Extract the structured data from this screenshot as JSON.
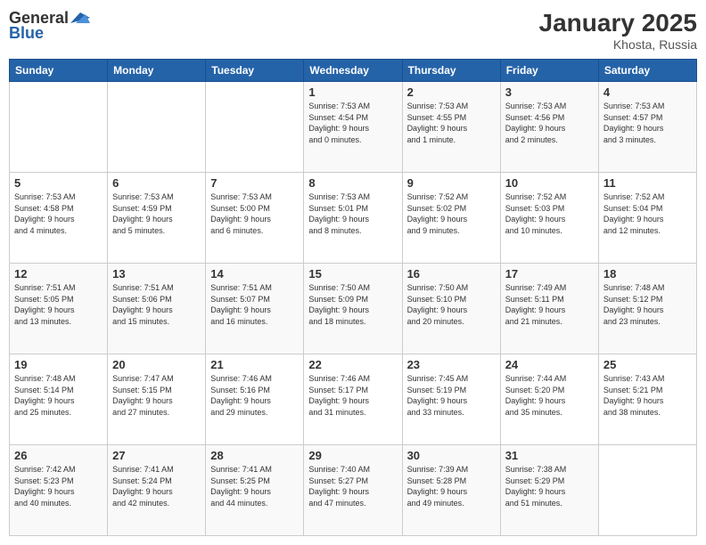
{
  "header": {
    "logo_general": "General",
    "logo_blue": "Blue",
    "month": "January 2025",
    "location": "Khosta, Russia"
  },
  "days_of_week": [
    "Sunday",
    "Monday",
    "Tuesday",
    "Wednesday",
    "Thursday",
    "Friday",
    "Saturday"
  ],
  "weeks": [
    [
      {
        "day": "",
        "info": ""
      },
      {
        "day": "",
        "info": ""
      },
      {
        "day": "",
        "info": ""
      },
      {
        "day": "1",
        "info": "Sunrise: 7:53 AM\nSunset: 4:54 PM\nDaylight: 9 hours\nand 0 minutes."
      },
      {
        "day": "2",
        "info": "Sunrise: 7:53 AM\nSunset: 4:55 PM\nDaylight: 9 hours\nand 1 minute."
      },
      {
        "day": "3",
        "info": "Sunrise: 7:53 AM\nSunset: 4:56 PM\nDaylight: 9 hours\nand 2 minutes."
      },
      {
        "day": "4",
        "info": "Sunrise: 7:53 AM\nSunset: 4:57 PM\nDaylight: 9 hours\nand 3 minutes."
      }
    ],
    [
      {
        "day": "5",
        "info": "Sunrise: 7:53 AM\nSunset: 4:58 PM\nDaylight: 9 hours\nand 4 minutes."
      },
      {
        "day": "6",
        "info": "Sunrise: 7:53 AM\nSunset: 4:59 PM\nDaylight: 9 hours\nand 5 minutes."
      },
      {
        "day": "7",
        "info": "Sunrise: 7:53 AM\nSunset: 5:00 PM\nDaylight: 9 hours\nand 6 minutes."
      },
      {
        "day": "8",
        "info": "Sunrise: 7:53 AM\nSunset: 5:01 PM\nDaylight: 9 hours\nand 8 minutes."
      },
      {
        "day": "9",
        "info": "Sunrise: 7:52 AM\nSunset: 5:02 PM\nDaylight: 9 hours\nand 9 minutes."
      },
      {
        "day": "10",
        "info": "Sunrise: 7:52 AM\nSunset: 5:03 PM\nDaylight: 9 hours\nand 10 minutes."
      },
      {
        "day": "11",
        "info": "Sunrise: 7:52 AM\nSunset: 5:04 PM\nDaylight: 9 hours\nand 12 minutes."
      }
    ],
    [
      {
        "day": "12",
        "info": "Sunrise: 7:51 AM\nSunset: 5:05 PM\nDaylight: 9 hours\nand 13 minutes."
      },
      {
        "day": "13",
        "info": "Sunrise: 7:51 AM\nSunset: 5:06 PM\nDaylight: 9 hours\nand 15 minutes."
      },
      {
        "day": "14",
        "info": "Sunrise: 7:51 AM\nSunset: 5:07 PM\nDaylight: 9 hours\nand 16 minutes."
      },
      {
        "day": "15",
        "info": "Sunrise: 7:50 AM\nSunset: 5:09 PM\nDaylight: 9 hours\nand 18 minutes."
      },
      {
        "day": "16",
        "info": "Sunrise: 7:50 AM\nSunset: 5:10 PM\nDaylight: 9 hours\nand 20 minutes."
      },
      {
        "day": "17",
        "info": "Sunrise: 7:49 AM\nSunset: 5:11 PM\nDaylight: 9 hours\nand 21 minutes."
      },
      {
        "day": "18",
        "info": "Sunrise: 7:48 AM\nSunset: 5:12 PM\nDaylight: 9 hours\nand 23 minutes."
      }
    ],
    [
      {
        "day": "19",
        "info": "Sunrise: 7:48 AM\nSunset: 5:14 PM\nDaylight: 9 hours\nand 25 minutes."
      },
      {
        "day": "20",
        "info": "Sunrise: 7:47 AM\nSunset: 5:15 PM\nDaylight: 9 hours\nand 27 minutes."
      },
      {
        "day": "21",
        "info": "Sunrise: 7:46 AM\nSunset: 5:16 PM\nDaylight: 9 hours\nand 29 minutes."
      },
      {
        "day": "22",
        "info": "Sunrise: 7:46 AM\nSunset: 5:17 PM\nDaylight: 9 hours\nand 31 minutes."
      },
      {
        "day": "23",
        "info": "Sunrise: 7:45 AM\nSunset: 5:19 PM\nDaylight: 9 hours\nand 33 minutes."
      },
      {
        "day": "24",
        "info": "Sunrise: 7:44 AM\nSunset: 5:20 PM\nDaylight: 9 hours\nand 35 minutes."
      },
      {
        "day": "25",
        "info": "Sunrise: 7:43 AM\nSunset: 5:21 PM\nDaylight: 9 hours\nand 38 minutes."
      }
    ],
    [
      {
        "day": "26",
        "info": "Sunrise: 7:42 AM\nSunset: 5:23 PM\nDaylight: 9 hours\nand 40 minutes."
      },
      {
        "day": "27",
        "info": "Sunrise: 7:41 AM\nSunset: 5:24 PM\nDaylight: 9 hours\nand 42 minutes."
      },
      {
        "day": "28",
        "info": "Sunrise: 7:41 AM\nSunset: 5:25 PM\nDaylight: 9 hours\nand 44 minutes."
      },
      {
        "day": "29",
        "info": "Sunrise: 7:40 AM\nSunset: 5:27 PM\nDaylight: 9 hours\nand 47 minutes."
      },
      {
        "day": "30",
        "info": "Sunrise: 7:39 AM\nSunset: 5:28 PM\nDaylight: 9 hours\nand 49 minutes."
      },
      {
        "day": "31",
        "info": "Sunrise: 7:38 AM\nSunset: 5:29 PM\nDaylight: 9 hours\nand 51 minutes."
      },
      {
        "day": "",
        "info": ""
      }
    ]
  ]
}
